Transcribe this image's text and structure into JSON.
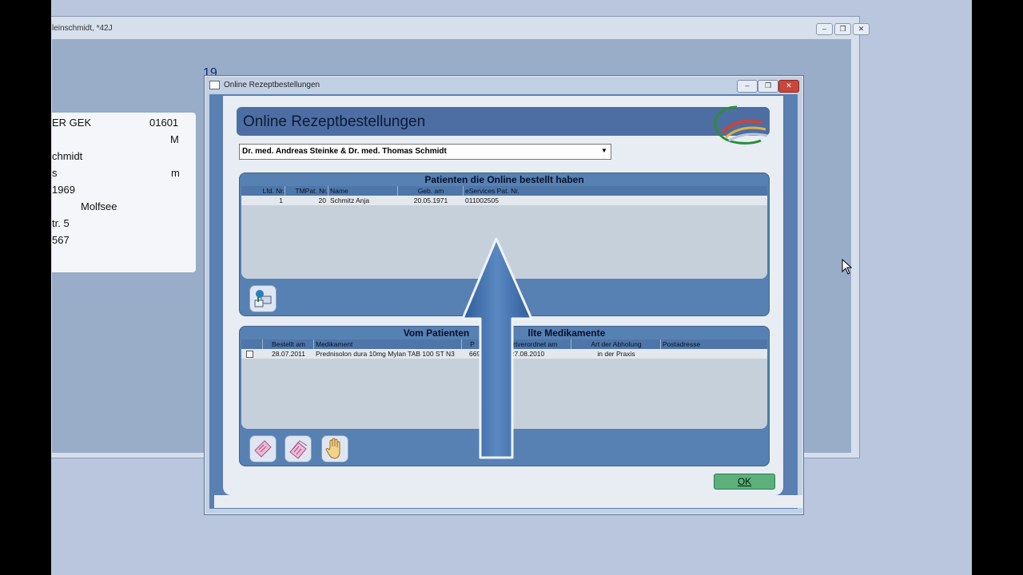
{
  "background_window": {
    "title": "leinschmidt, *42J",
    "number": "19",
    "card_lines": [
      "ER GEK",
      "01601",
      "M",
      "chmidt",
      "s",
      "m",
      "1969",
      "Molfsee",
      "tr. 5",
      "567"
    ]
  },
  "dialog": {
    "title": "Online Rezeptbestellungen",
    "heading": "Online Rezeptbestellungen",
    "doctor_select": {
      "value": "Dr. med. Andreas Steinke & Dr. med. Thomas Schmidt"
    },
    "patients": {
      "header": "Patienten die Online bestellt haben",
      "columns": [
        "Lfd. Nr.",
        "TMPat. Nr.",
        "Name",
        "Geb. am",
        "eServices Pat. Nr."
      ],
      "rows": [
        [
          "1",
          "20",
          "Schmitz Anja",
          "20.05.1971",
          "011002505"
        ]
      ]
    },
    "medications": {
      "header_left": "Vom Patienten",
      "header_right": "llte Medikamente",
      "columns": [
        "Bestellt am",
        "Medikament",
        "P",
        "zuletztverordnet am",
        "Art der Abholung",
        "Postadresse"
      ],
      "rows": [
        [
          "28.07.2011",
          "Prednisolon dura 10mg Mylan TAB 100 ST N3",
          "669",
          "27.08.2010",
          "in der Praxis",
          ""
        ]
      ]
    },
    "ok_label": "OK"
  },
  "icons": {
    "import": "patient-import-icon",
    "prescription1": "prescription-card-icon",
    "prescription2": "prescription-stack-icon",
    "reject": "hand-stop-icon",
    "arrow": "big-up-arrow"
  }
}
